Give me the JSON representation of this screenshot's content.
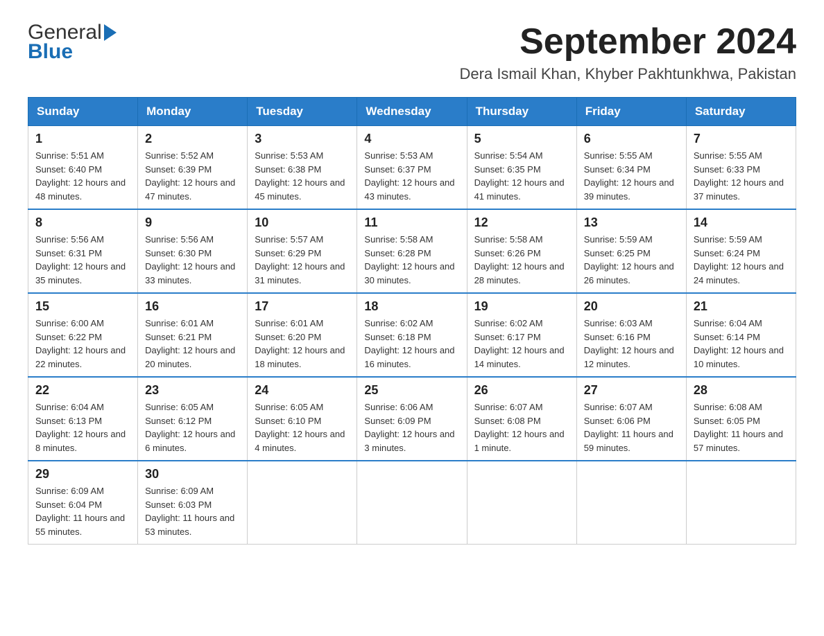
{
  "header": {
    "logo_general": "General",
    "logo_blue": "Blue",
    "main_title": "September 2024",
    "subtitle": "Dera Ismail Khan, Khyber Pakhtunkhwa, Pakistan"
  },
  "calendar": {
    "days_of_week": [
      "Sunday",
      "Monday",
      "Tuesday",
      "Wednesday",
      "Thursday",
      "Friday",
      "Saturday"
    ],
    "weeks": [
      [
        {
          "date": "1",
          "sunrise": "Sunrise: 5:51 AM",
          "sunset": "Sunset: 6:40 PM",
          "daylight": "Daylight: 12 hours and 48 minutes."
        },
        {
          "date": "2",
          "sunrise": "Sunrise: 5:52 AM",
          "sunset": "Sunset: 6:39 PM",
          "daylight": "Daylight: 12 hours and 47 minutes."
        },
        {
          "date": "3",
          "sunrise": "Sunrise: 5:53 AM",
          "sunset": "Sunset: 6:38 PM",
          "daylight": "Daylight: 12 hours and 45 minutes."
        },
        {
          "date": "4",
          "sunrise": "Sunrise: 5:53 AM",
          "sunset": "Sunset: 6:37 PM",
          "daylight": "Daylight: 12 hours and 43 minutes."
        },
        {
          "date": "5",
          "sunrise": "Sunrise: 5:54 AM",
          "sunset": "Sunset: 6:35 PM",
          "daylight": "Daylight: 12 hours and 41 minutes."
        },
        {
          "date": "6",
          "sunrise": "Sunrise: 5:55 AM",
          "sunset": "Sunset: 6:34 PM",
          "daylight": "Daylight: 12 hours and 39 minutes."
        },
        {
          "date": "7",
          "sunrise": "Sunrise: 5:55 AM",
          "sunset": "Sunset: 6:33 PM",
          "daylight": "Daylight: 12 hours and 37 minutes."
        }
      ],
      [
        {
          "date": "8",
          "sunrise": "Sunrise: 5:56 AM",
          "sunset": "Sunset: 6:31 PM",
          "daylight": "Daylight: 12 hours and 35 minutes."
        },
        {
          "date": "9",
          "sunrise": "Sunrise: 5:56 AM",
          "sunset": "Sunset: 6:30 PM",
          "daylight": "Daylight: 12 hours and 33 minutes."
        },
        {
          "date": "10",
          "sunrise": "Sunrise: 5:57 AM",
          "sunset": "Sunset: 6:29 PM",
          "daylight": "Daylight: 12 hours and 31 minutes."
        },
        {
          "date": "11",
          "sunrise": "Sunrise: 5:58 AM",
          "sunset": "Sunset: 6:28 PM",
          "daylight": "Daylight: 12 hours and 30 minutes."
        },
        {
          "date": "12",
          "sunrise": "Sunrise: 5:58 AM",
          "sunset": "Sunset: 6:26 PM",
          "daylight": "Daylight: 12 hours and 28 minutes."
        },
        {
          "date": "13",
          "sunrise": "Sunrise: 5:59 AM",
          "sunset": "Sunset: 6:25 PM",
          "daylight": "Daylight: 12 hours and 26 minutes."
        },
        {
          "date": "14",
          "sunrise": "Sunrise: 5:59 AM",
          "sunset": "Sunset: 6:24 PM",
          "daylight": "Daylight: 12 hours and 24 minutes."
        }
      ],
      [
        {
          "date": "15",
          "sunrise": "Sunrise: 6:00 AM",
          "sunset": "Sunset: 6:22 PM",
          "daylight": "Daylight: 12 hours and 22 minutes."
        },
        {
          "date": "16",
          "sunrise": "Sunrise: 6:01 AM",
          "sunset": "Sunset: 6:21 PM",
          "daylight": "Daylight: 12 hours and 20 minutes."
        },
        {
          "date": "17",
          "sunrise": "Sunrise: 6:01 AM",
          "sunset": "Sunset: 6:20 PM",
          "daylight": "Daylight: 12 hours and 18 minutes."
        },
        {
          "date": "18",
          "sunrise": "Sunrise: 6:02 AM",
          "sunset": "Sunset: 6:18 PM",
          "daylight": "Daylight: 12 hours and 16 minutes."
        },
        {
          "date": "19",
          "sunrise": "Sunrise: 6:02 AM",
          "sunset": "Sunset: 6:17 PM",
          "daylight": "Daylight: 12 hours and 14 minutes."
        },
        {
          "date": "20",
          "sunrise": "Sunrise: 6:03 AM",
          "sunset": "Sunset: 6:16 PM",
          "daylight": "Daylight: 12 hours and 12 minutes."
        },
        {
          "date": "21",
          "sunrise": "Sunrise: 6:04 AM",
          "sunset": "Sunset: 6:14 PM",
          "daylight": "Daylight: 12 hours and 10 minutes."
        }
      ],
      [
        {
          "date": "22",
          "sunrise": "Sunrise: 6:04 AM",
          "sunset": "Sunset: 6:13 PM",
          "daylight": "Daylight: 12 hours and 8 minutes."
        },
        {
          "date": "23",
          "sunrise": "Sunrise: 6:05 AM",
          "sunset": "Sunset: 6:12 PM",
          "daylight": "Daylight: 12 hours and 6 minutes."
        },
        {
          "date": "24",
          "sunrise": "Sunrise: 6:05 AM",
          "sunset": "Sunset: 6:10 PM",
          "daylight": "Daylight: 12 hours and 4 minutes."
        },
        {
          "date": "25",
          "sunrise": "Sunrise: 6:06 AM",
          "sunset": "Sunset: 6:09 PM",
          "daylight": "Daylight: 12 hours and 3 minutes."
        },
        {
          "date": "26",
          "sunrise": "Sunrise: 6:07 AM",
          "sunset": "Sunset: 6:08 PM",
          "daylight": "Daylight: 12 hours and 1 minute."
        },
        {
          "date": "27",
          "sunrise": "Sunrise: 6:07 AM",
          "sunset": "Sunset: 6:06 PM",
          "daylight": "Daylight: 11 hours and 59 minutes."
        },
        {
          "date": "28",
          "sunrise": "Sunrise: 6:08 AM",
          "sunset": "Sunset: 6:05 PM",
          "daylight": "Daylight: 11 hours and 57 minutes."
        }
      ],
      [
        {
          "date": "29",
          "sunrise": "Sunrise: 6:09 AM",
          "sunset": "Sunset: 6:04 PM",
          "daylight": "Daylight: 11 hours and 55 minutes."
        },
        {
          "date": "30",
          "sunrise": "Sunrise: 6:09 AM",
          "sunset": "Sunset: 6:03 PM",
          "daylight": "Daylight: 11 hours and 53 minutes."
        },
        null,
        null,
        null,
        null,
        null
      ]
    ]
  }
}
